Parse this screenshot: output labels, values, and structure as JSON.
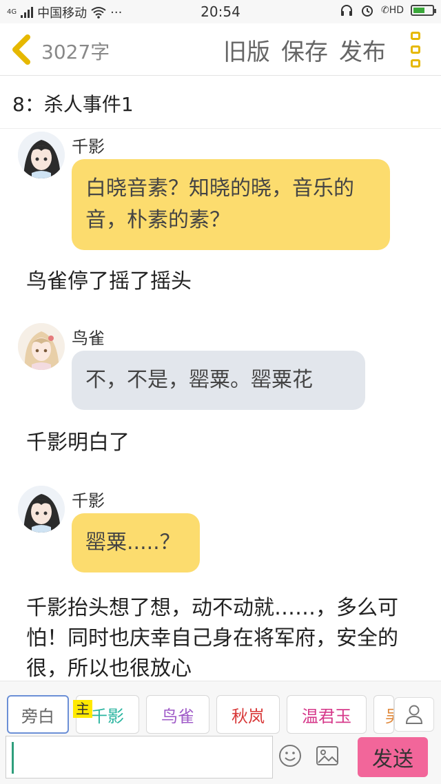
{
  "status_bar": {
    "network": "4G",
    "carrier": "中国移动",
    "dots": "···",
    "time": "20:54",
    "hd": "HD",
    "icons": [
      "signal-icon",
      "wifi-icon",
      "headphones-icon",
      "alarm-icon",
      "call-hd-icon",
      "battery-icon"
    ],
    "battery_level": 0.6
  },
  "top_bar": {
    "word_count": "3027字",
    "old_version": "旧版",
    "save": "保存",
    "publish": "发布",
    "accent_color": "#e6b800"
  },
  "chapter": {
    "title": "8：杀人事件1"
  },
  "messages": [
    {
      "type": "dialogue",
      "speaker": "千影",
      "text": "白晓音素？知晓的晓，音乐的音，朴素的素？",
      "bubble_color": "#fcdc6e"
    },
    {
      "type": "narration",
      "text": "鸟雀停了摇了摇头"
    },
    {
      "type": "dialogue",
      "speaker": "鸟雀",
      "text": "不，不是，罂粟。罂粟花",
      "bubble_color": "#e2e6ec"
    },
    {
      "type": "narration",
      "text": "千影明白了"
    },
    {
      "type": "dialogue",
      "speaker": "千影",
      "text": "罂粟.....？",
      "bubble_color": "#fcdc6e"
    },
    {
      "type": "narration",
      "text": "千影抬头想了想，动不动就……，多么可怕！同时也庆幸自己身在将军府，安全的很，所以也很放心"
    }
  ],
  "role_bar": {
    "main_tag": "主",
    "roles": [
      {
        "label": "旁白",
        "color": "#666666",
        "active": true
      },
      {
        "label": "千影",
        "color": "#2bb5a0",
        "active": false
      },
      {
        "label": "鸟雀",
        "color": "#a05cc8",
        "active": false
      },
      {
        "label": "秋岚",
        "color": "#d83838",
        "active": false
      },
      {
        "label": "温君玉",
        "color": "#d6388a",
        "active": false
      },
      {
        "label": "吴",
        "color": "#e0883a",
        "active": false
      }
    ]
  },
  "input_bar": {
    "text": "",
    "send": "发送",
    "send_color": "#f2669a"
  }
}
